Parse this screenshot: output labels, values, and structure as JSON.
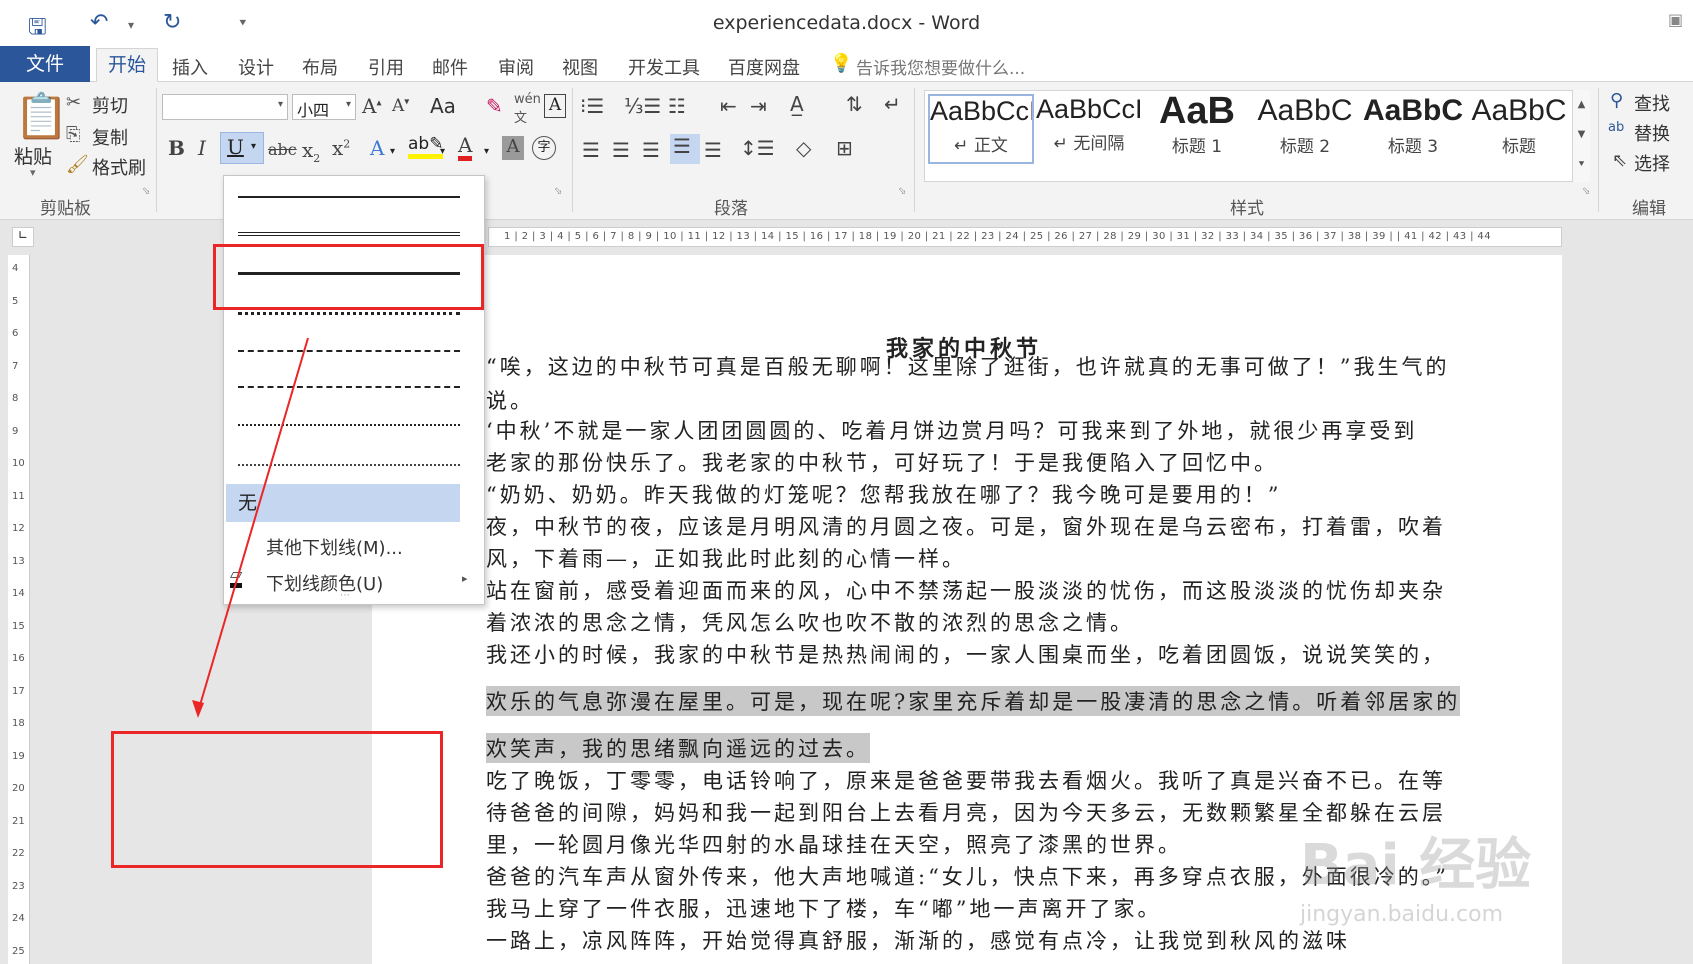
{
  "window": {
    "title": "experiencedata.docx - Word"
  },
  "tabs": [
    "文件",
    "开始",
    "插入",
    "设计",
    "布局",
    "引用",
    "邮件",
    "审阅",
    "视图",
    "开发工具",
    "百度网盘"
  ],
  "tell_me": "告诉我您想要做什么...",
  "clipboard": {
    "paste": "粘贴",
    "cut": "剪切",
    "copy": "复制",
    "format_painter": "格式刷",
    "label": "剪贴板"
  },
  "font": {
    "name_value": "",
    "size_value": "小四",
    "clear": "Aa"
  },
  "paragraph": {
    "label": "段落"
  },
  "styles": {
    "label": "样式",
    "items": [
      {
        "sample": "AaBbCcI",
        "name": "↵ 正文"
      },
      {
        "sample": "AaBbCcI",
        "name": "↵ 无间隔"
      },
      {
        "sample": "AaB",
        "name": "标题 1"
      },
      {
        "sample": "AaBbC",
        "name": "标题 2"
      },
      {
        "sample": "AaBbC",
        "name": "标题 3"
      },
      {
        "sample": "AaBbC",
        "name": "标题"
      }
    ]
  },
  "editing": {
    "find": "查找",
    "replace": "替换",
    "select": "选择",
    "label": "编辑"
  },
  "ruler": "1 | 2 | 3 | 4 | 5 | 6 | 7 | 8 | 9 | 10 | 11 | 12 | 13 | 14 | 15 | 16 | 17 | 18 | 19 | 20 | 21 | 22 | 23 | 24 | 25 | 26 | 27 | 28 | 29 | 30 | 31 | 32 | 33 | 34 | 35 | 36 | 37 | 38 | 39 |   | 41 | 42 | 43 | 44",
  "vruler": [
    "4",
    "5",
    "6",
    "7",
    "8",
    "9",
    "10",
    "11",
    "12",
    "13",
    "14",
    "15",
    "16",
    "17",
    "18",
    "19",
    "20",
    "21",
    "22",
    "23",
    "24",
    "25"
  ],
  "underline_menu": {
    "none": "无",
    "more": "其他下划线(M)...",
    "color": "下划线颜色(U)"
  },
  "document": {
    "title": "我家的中秋节",
    "lines": [
      "“唉，这边的中秋节可真是百般无聊啊！这里除了逛街，也许就真的无事可做了！”我生气的",
      "说。",
      "‘中秋’不就是一家人团团圆圆的、吃着月饼边赏月吗？可我来到了外地，就很少再享受到",
      "老家的那份快乐了。我老家的中秋节，可好玩了！于是我便陷入了回忆中。",
      "“奶奶、奶奶。昨天我做的灯笼呢？您帮我放在哪了？我今晚可是要用的！”",
      "夜，中秋节的夜，应该是月明风清的月圆之夜。可是，窗外现在是乌云密布，打着雷，吹着",
      "风，下着雨—，正如我此时此刻的心情一样。",
      "站在窗前，感受着迎面而来的风，心中不禁荡起一股淡淡的忧伤，而这股淡淡的忧伤却夹杂",
      "着浓浓的思念之情，凭风怎么吹也吹不散的浓烈的思念之情。",
      "我还小的时候，我家的中秋节是热热闹闹的，一家人围桌而坐，吃着团圆饭，说说笑笑的，",
      "欢乐的气息弥漫在屋里。可是，现在呢?家里充斥着却是一股凄清的思念之情。听着邻居家的",
      "欢笑声，我的思绪飘向遥远的过去。",
      "吃了晚饭，丁零零，电话铃响了，原来是爸爸要带我去看烟火。我听了真是兴奋不已。在等",
      "待爸爸的间隙，妈妈和我一起到阳台上去看月亮，因为今天多云，无数颗繁星全都躲在云层",
      "里，一轮圆月像光华四射的水晶球挂在天空，照亮了漆黑的世界。",
      "爸爸的汽车声从窗外传来，他大声地喊道:“女儿，快点下来，再多穿点衣服，外面很冷的。”",
      "我马上穿了一件衣服，迅速地下了楼，车“嘟”地一声离开了家。",
      "一路上，凉风阵阵，开始觉得真舒服，渐渐的，感觉有点冷，让我觉到秋风的滋味"
    ]
  },
  "watermark": {
    "main": "Bai 经验",
    "sub": "jingyan.baidu.com"
  }
}
